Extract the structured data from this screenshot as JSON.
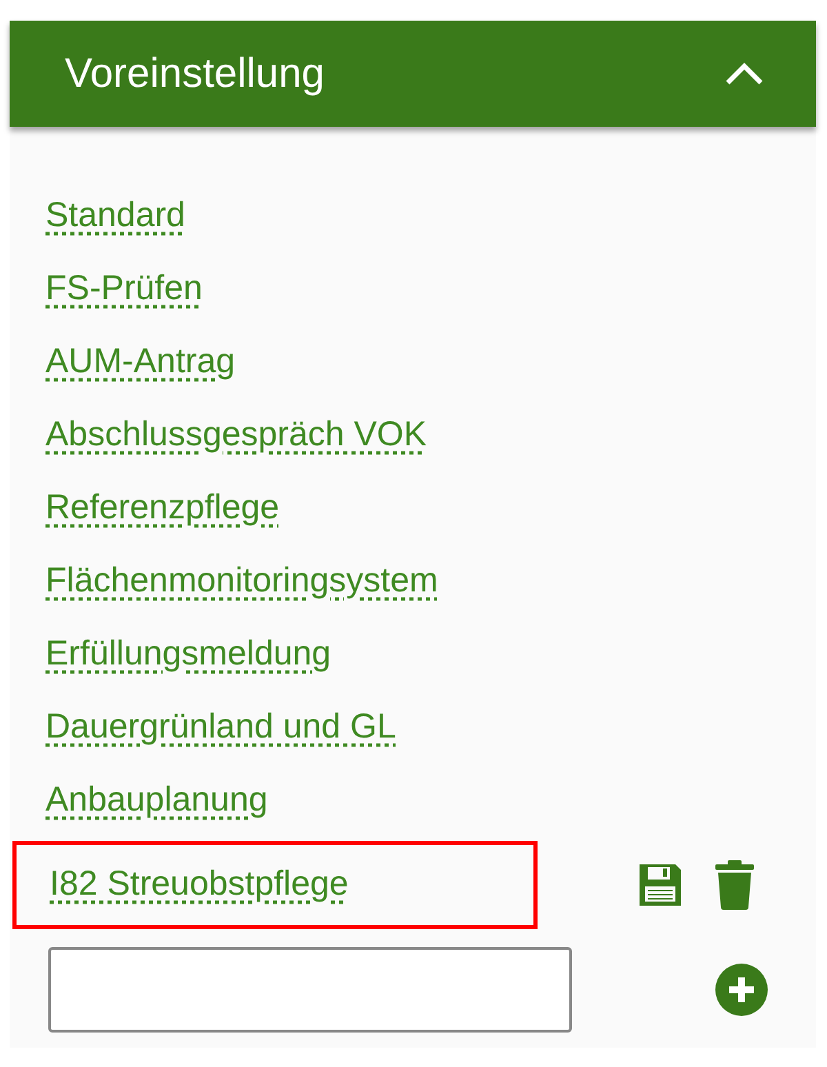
{
  "panel": {
    "title": "Voreinstellung",
    "expanded": true
  },
  "presets": [
    {
      "label": "Standard",
      "selected": false
    },
    {
      "label": "FS-Prüfen",
      "selected": false
    },
    {
      "label": "AUM-Antrag",
      "selected": false
    },
    {
      "label": "Abschlussgespräch VOK",
      "selected": false
    },
    {
      "label": "Referenzpflege",
      "selected": false
    },
    {
      "label": "Flächenmonitoringsystem",
      "selected": false
    },
    {
      "label": "Erfüllungsmeldung",
      "selected": false
    },
    {
      "label": "Dauergrünland und GL",
      "selected": false
    },
    {
      "label": "Anbauplanung",
      "selected": false
    },
    {
      "label": "I82 Streuobstpflege",
      "selected": true
    }
  ]
}
